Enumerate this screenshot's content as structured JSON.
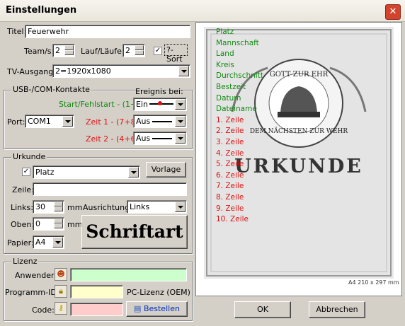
{
  "window": {
    "title": "Einstellungen",
    "close_glyph": "✕"
  },
  "titel": {
    "label": "Titel:",
    "value": "Feuerwehr"
  },
  "teams": {
    "label": "Team/s:",
    "value": "2"
  },
  "laeufe": {
    "label": "Lauf/Läufe:",
    "value": "2"
  },
  "sort": {
    "checked": true,
    "label": "?-Sort"
  },
  "tv": {
    "label": "TV-Ausgang:",
    "value": "2=1920x1080"
  },
  "usb": {
    "group_label": "USB-/COM-Kontakte",
    "ereignis_label": "Ereignis bei:",
    "port_label": "Port:",
    "port_value": "COM1",
    "start_label": "Start/Fehlstart - (1+4):",
    "start_value": "Ein",
    "zeit1_label": "Zeit 1 - (7+8):",
    "zeit1_value": "Aus",
    "zeit2_label": "Zeit 2 - (4+6):",
    "zeit2_value": "Aus"
  },
  "urkunde": {
    "group_label": "Urkunde",
    "checked": true,
    "select_value": "Platz",
    "vorlage_label": "Vorlage",
    "zeile_label": "Zeile:",
    "zeile_value": "",
    "links_label": "Links:",
    "links_value": "30",
    "links_unit": "mm",
    "ausrichtung_label": "Ausrichtung:",
    "ausrichtung_value": "Links",
    "oben_label": "Oben:",
    "oben_value": "0",
    "oben_unit": "mm",
    "papier_label": "Papier:",
    "papier_value": "A4",
    "schriftart_label": "Schriftart"
  },
  "lizenz": {
    "group_label": "Lizenz",
    "anwender_label": "Anwender:",
    "anwender_value": "",
    "programm_label": "Programm-ID:",
    "programm_value": "",
    "pc_lizenz": "PC-Lizenz (OEM)",
    "code_label": "Code:",
    "code_value": "",
    "bestellen_label": "Bestellen",
    "colors": {
      "anwender": "#ccffcc",
      "programm": "#ffffcc",
      "code": "#ffcccc"
    }
  },
  "preview": {
    "lines_green": [
      "Platz",
      "Mannschaft",
      "Land",
      "Kreis",
      "Durchschnitt",
      "Bestzeit",
      "Datum",
      "Dateiname"
    ],
    "lines_red": [
      "1. Zeile",
      "2. Zeile",
      "3. Zeile",
      "4. Zeile",
      "5. Zeile",
      "6. Zeile",
      "7. Zeile",
      "8. Zeile",
      "9. Zeile",
      "10. Zeile"
    ],
    "cert_motto_top": "GOTT ZUR EHR",
    "cert_motto_bottom": "DEM NÄCHSTEN ZUR WEHR",
    "cert_title": "URKUNDE",
    "paper_info": "A4 210 x 297 mm"
  },
  "buttons": {
    "ok": "OK",
    "cancel": "Abbrechen"
  },
  "icons": [
    "close-icon",
    "person-icon",
    "lock-icon",
    "key-icon",
    "order-icon",
    "fire-helmet-emblem"
  ]
}
